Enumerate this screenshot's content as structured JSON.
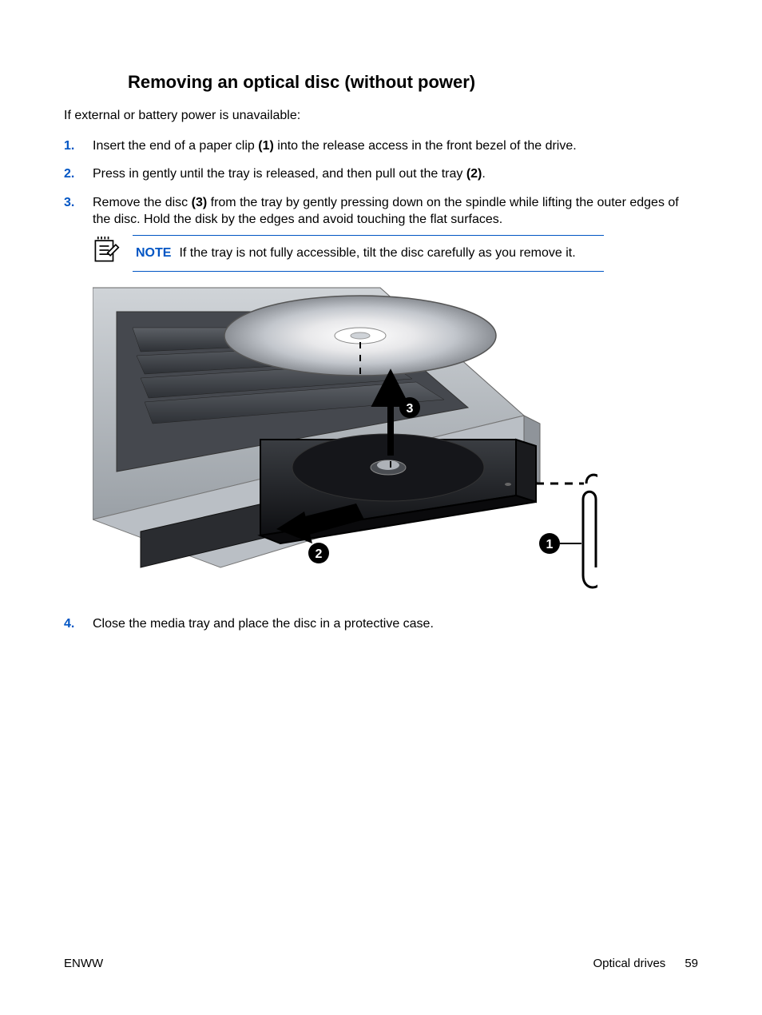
{
  "heading": "Removing an optical disc (without power)",
  "intro": "If external or battery power is unavailable:",
  "steps": [
    {
      "num": "1.",
      "pre": "Insert the end of a paper clip ",
      "ref": "(1)",
      "post": " into the release access in the front bezel of the drive."
    },
    {
      "num": "2.",
      "pre": "Press in gently until the tray is released, and then pull out the tray ",
      "ref": "(2)",
      "post": "."
    },
    {
      "num": "3.",
      "pre": "Remove the disc ",
      "ref": "(3)",
      "post": " from the tray by gently pressing down on the spindle while lifting the outer edges of the disc. Hold the disk by the edges and avoid touching the flat surfaces."
    },
    {
      "num": "4.",
      "pre": "Close the media tray and place the disc in a protective case.",
      "ref": "",
      "post": ""
    }
  ],
  "note": {
    "label": "NOTE",
    "text": "If the tray is not fully accessible, tilt the disc carefully as you remove it."
  },
  "callouts": {
    "c1": "1",
    "c2": "2",
    "c3": "3"
  },
  "footer": {
    "left": "ENWW",
    "section": "Optical drives",
    "page": "59"
  }
}
